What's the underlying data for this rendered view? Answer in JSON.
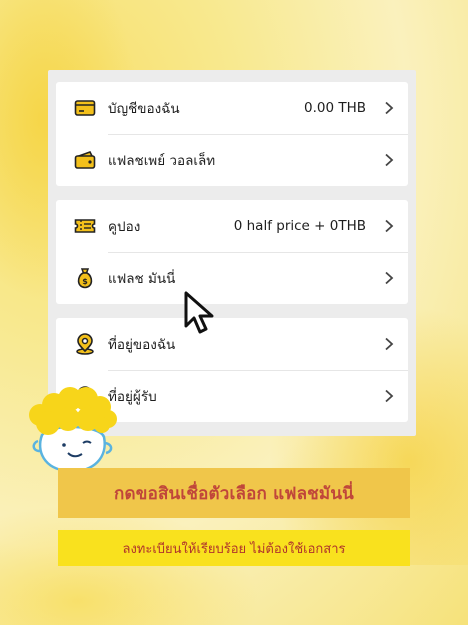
{
  "menu_group_1": [
    {
      "label": "บัญชีของฉัน",
      "value": "0.00 THB",
      "icon": "wallet-card-icon"
    },
    {
      "label": "แฟลชเพย์ วอลเล็ท",
      "value": "",
      "icon": "flash-wallet-icon"
    }
  ],
  "menu_group_2": [
    {
      "label": "คูปอง",
      "value": "0 half price + 0THB",
      "icon": "coupon-icon"
    },
    {
      "label": "แฟลช มันนี่",
      "value": "",
      "icon": "money-bag-icon"
    }
  ],
  "menu_group_3": [
    {
      "label": "ที่อยู่ของฉัน",
      "value": "",
      "icon": "location-pin-icon"
    },
    {
      "label": "ที่อยู่ผู้รับ",
      "value": "",
      "icon": "recipient-location-icon"
    }
  ],
  "banner": {
    "headline": "กดขอสินเชื่อตัวเลือก แฟลชมันนี่",
    "subline": "ลงทะเบียนให้เรียบร้อย ไม่ต้องใช้เอกสาร"
  },
  "colors": {
    "icon_yellow": "#f3c01b",
    "icon_outline": "#222222",
    "headline_bg": "#f0c64a",
    "subline_bg": "#f9e11e",
    "banner_text": "#c0463a"
  }
}
